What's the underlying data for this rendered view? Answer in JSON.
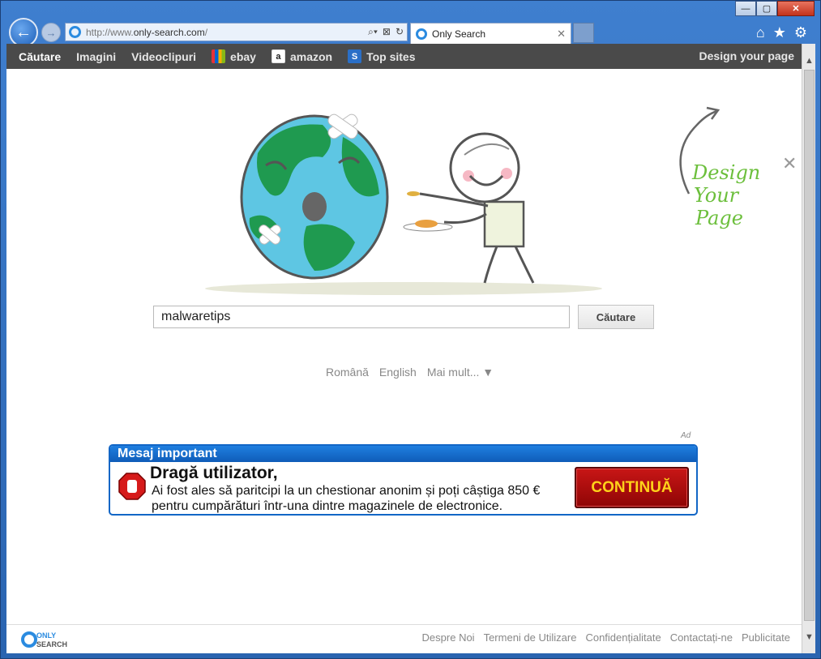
{
  "browser": {
    "url_prefix": "http://www.",
    "url_domain": "only-search.com",
    "url_suffix": "/",
    "tab_title": "Only Search",
    "tab_close": "✕",
    "win_minimize": "—",
    "win_maximize": "▢",
    "win_close": "✕",
    "back_glyph": "←",
    "forward_glyph": "→",
    "addr_search_glyph": "⌕▾",
    "addr_compat_glyph": "⊠",
    "addr_refresh_glyph": "↻",
    "home_glyph": "⌂",
    "fav_glyph": "★",
    "tools_glyph": "⚙"
  },
  "topbar": {
    "items": [
      {
        "label": "Căutare"
      },
      {
        "label": "Imagini"
      },
      {
        "label": "Videoclipuri"
      },
      {
        "label": "ebay",
        "icon": "ebay-icon"
      },
      {
        "label": "amazon",
        "icon": "amazon-icon"
      },
      {
        "label": "Top sites",
        "icon": "top-sites-icon"
      }
    ],
    "amazon_icon_glyph": "a",
    "top_sites_icon_glyph": "S",
    "design_link": "Design your page"
  },
  "design_panel": {
    "line1": "Design",
    "line2": "Your",
    "line3": "Page",
    "close_glyph": "✕"
  },
  "search": {
    "value": "malwaretips",
    "button": "Căutare"
  },
  "languages": {
    "lang1": "Română",
    "lang2": "English",
    "more": "Mai mult... ▼"
  },
  "ad": {
    "label": "Ad",
    "header": "Mesaj important",
    "title": "Dragă utilizator,",
    "body": "Ai fost ales să paritcipi la un chestionar anonim și poți câștiga 850 € pentru cumpărături într-una dintre magazinele de electronice.",
    "cta": "CONTINUĂ"
  },
  "footer": {
    "logo_top": "ONLY",
    "logo_bottom": "SEARCH",
    "links": [
      "Despre Noi",
      "Termeni de Utilizare",
      "Confidențialitate",
      "Contactați-ne",
      "Publicitate"
    ]
  },
  "colors": {
    "frame_blue": "#2b63a8",
    "topbar_bg": "#4a4a4a",
    "ad_blue": "#1266c6",
    "cta_red": "#c81616",
    "cta_text": "#ffd21a",
    "design_green": "#6cbf3c"
  }
}
